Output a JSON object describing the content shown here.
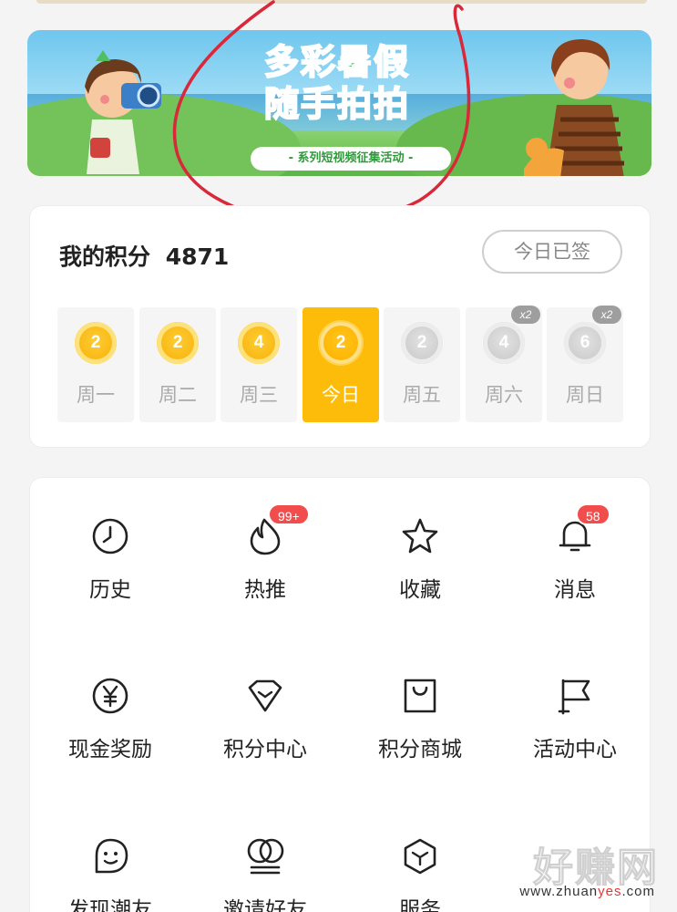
{
  "banner": {
    "title_line1": "多彩暑假",
    "title_line2": "随手拍拍",
    "subtitle": "- 系列短视频征集活动 -"
  },
  "points": {
    "label": "我的积分",
    "value": "4871",
    "signed_button": "今日已签",
    "days": [
      {
        "label": "周一",
        "coins": "2",
        "state": "claimed",
        "multiplier": ""
      },
      {
        "label": "周二",
        "coins": "2",
        "state": "claimed",
        "multiplier": ""
      },
      {
        "label": "周三",
        "coins": "4",
        "state": "claimed",
        "multiplier": ""
      },
      {
        "label": "今日",
        "coins": "2",
        "state": "today",
        "multiplier": ""
      },
      {
        "label": "周五",
        "coins": "2",
        "state": "future",
        "multiplier": ""
      },
      {
        "label": "周六",
        "coins": "4",
        "state": "future",
        "multiplier": "x2"
      },
      {
        "label": "周日",
        "coins": "6",
        "state": "future",
        "multiplier": "x2"
      }
    ]
  },
  "menu": {
    "items": [
      {
        "label": "历史",
        "icon": "clock-icon",
        "badge": ""
      },
      {
        "label": "热推",
        "icon": "fire-icon",
        "badge": "99+"
      },
      {
        "label": "收藏",
        "icon": "star-icon",
        "badge": ""
      },
      {
        "label": "消息",
        "icon": "bell-icon",
        "badge": "58"
      },
      {
        "label": "现金奖励",
        "icon": "yen-icon",
        "badge": ""
      },
      {
        "label": "积分中心",
        "icon": "diamond-icon",
        "badge": ""
      },
      {
        "label": "积分商城",
        "icon": "shopping-bag-icon",
        "badge": ""
      },
      {
        "label": "活动中心",
        "icon": "flag-icon",
        "badge": ""
      },
      {
        "label": "发现潮友",
        "icon": "smile-icon",
        "badge": ""
      },
      {
        "label": "邀请好友",
        "icon": "friends-icon",
        "badge": ""
      },
      {
        "label": "服务",
        "icon": "cube-icon",
        "badge": ""
      }
    ]
  },
  "watermark": {
    "main": "好赚网",
    "sub_prefix": "www.zhuan",
    "sub_highlight": "yes",
    "sub_suffix": ".com"
  },
  "colors": {
    "today_yellow": "#fdbb0a",
    "badge_red": "#f24d4d",
    "annotation_red": "#d8283a"
  }
}
